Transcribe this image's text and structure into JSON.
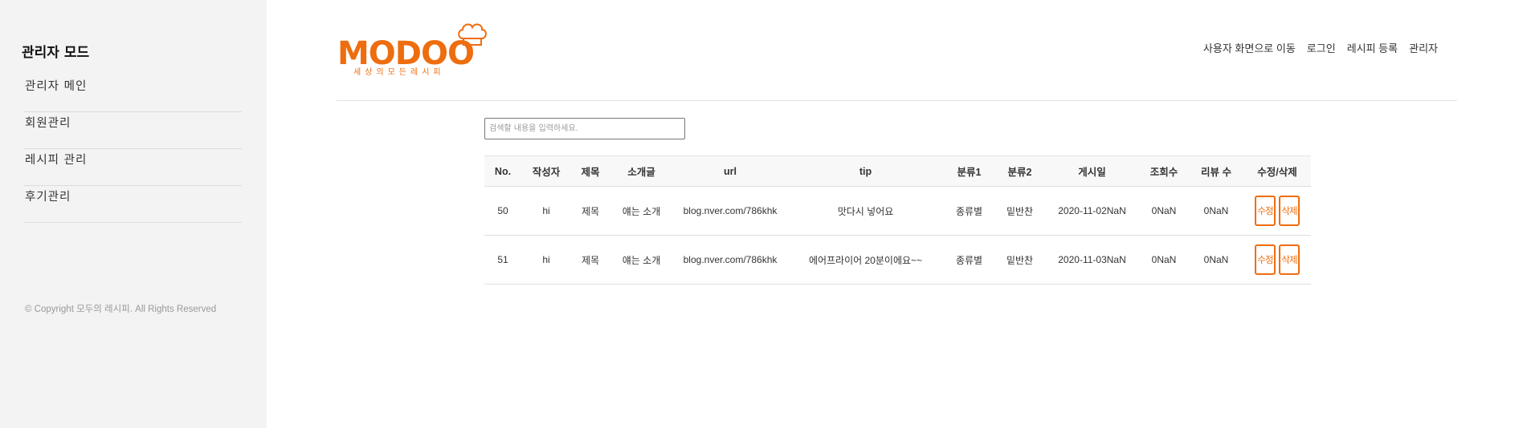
{
  "sidebar": {
    "title": "관리자 모드",
    "items": [
      {
        "label": "관리자 메인"
      },
      {
        "label": "회원관리"
      },
      {
        "label": "레시피 관리"
      },
      {
        "label": "후기관리"
      }
    ],
    "copyright": "© Copyright 모두의 레시피. All Rights Reserved"
  },
  "logo": {
    "word": "MODOO",
    "subtitle": "세상의모든레시피",
    "color": "#ee6d0f"
  },
  "header": {
    "nav": [
      {
        "label": "사용자 화면으로 이동"
      },
      {
        "label": "로그인"
      },
      {
        "label": "레시피 등록"
      },
      {
        "label": "관리자"
      }
    ]
  },
  "search": {
    "placeholder": "검색할 내용을 입력하세요.",
    "value": ""
  },
  "table": {
    "columns": [
      "No.",
      "작성자",
      "제목",
      "소개글",
      "url",
      "tip",
      "분류1",
      "분류2",
      "게시일",
      "조회수",
      "리뷰 수",
      "수정/삭제"
    ],
    "rows": [
      {
        "no": "50",
        "author": "hi",
        "title": "제목",
        "intro": "얘는 소개",
        "url": "blog.nver.com/786khk",
        "tip": "맛다시 넣어요",
        "cat1": "종류별",
        "cat2": "밑반찬",
        "date": "2020-11-02NaN",
        "views": "0NaN",
        "reviews": "0NaN",
        "edit": "수정",
        "delete": "삭제"
      },
      {
        "no": "51",
        "author": "hi",
        "title": "제목",
        "intro": "얘는 소개",
        "url": "blog.nver.com/786khk",
        "tip": "에어프라이어 20분이에요~~",
        "cat1": "종류별",
        "cat2": "밑반찬",
        "date": "2020-11-03NaN",
        "views": "0NaN",
        "reviews": "0NaN",
        "edit": "수정",
        "delete": "삭제"
      }
    ]
  },
  "colors": {
    "accent": "#ee6d0f",
    "sidebar_bg": "#f3f3f3"
  }
}
